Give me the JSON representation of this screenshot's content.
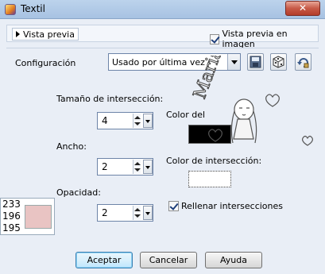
{
  "window": {
    "title": "Textil",
    "close_glyph": "✕"
  },
  "preview": {
    "toggle_label": "Vista previa",
    "on_image_label": "Vista previa en imagen",
    "on_image_checked": true
  },
  "config": {
    "label": "Configuración",
    "selected": "Usado por última vez"
  },
  "intersection_size": {
    "label": "Tamaño de intersección:",
    "value": "4"
  },
  "width": {
    "label": "Ancho:",
    "value": "2"
  },
  "opacity": {
    "label": "Opacidad:",
    "value": "2"
  },
  "tile_color": {
    "label": "Color del",
    "color": "#000000"
  },
  "intersection_color": {
    "label": "Color de intersección:",
    "color": "#ffffff"
  },
  "fill_intersections": {
    "label": "Rellenar intersecciones",
    "checked": true
  },
  "color_readout": {
    "r": "233",
    "g": "196",
    "b": "195",
    "color": "#e9c4c3"
  },
  "buttons": {
    "ok": "Aceptar",
    "cancel": "Cancelar",
    "help": "Ayuda"
  },
  "watermark": {
    "text": "Maria Elena"
  },
  "icons": {
    "app": "textil-app-icon",
    "save": "save-preset-icon",
    "random": "random-dice-icon",
    "reset": "reset-preset-icon"
  }
}
